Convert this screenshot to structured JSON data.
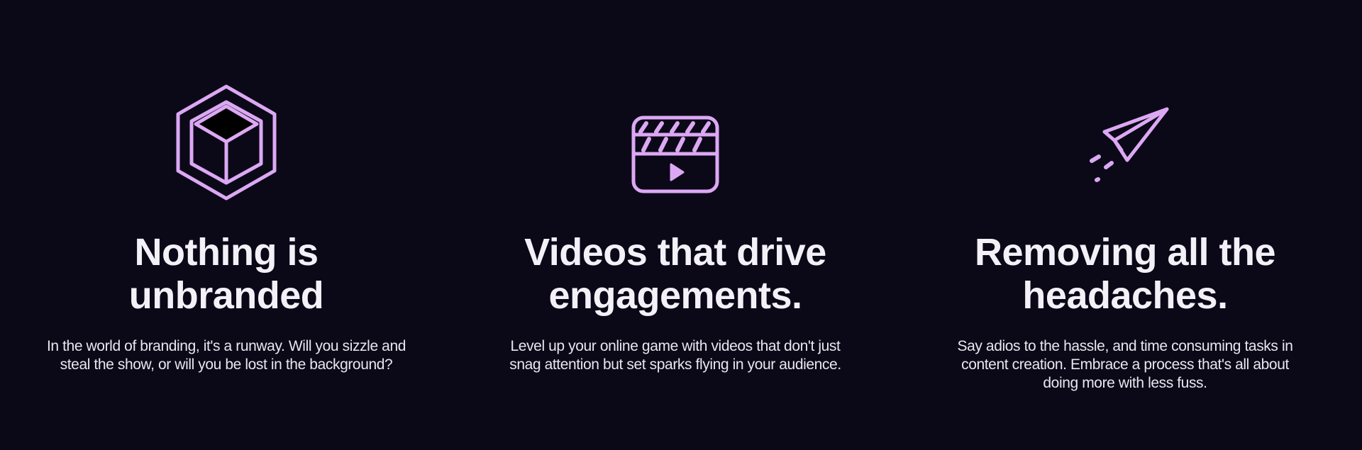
{
  "theme": {
    "background": "#0b0918",
    "accent": "#dca8f3",
    "text": "#f3f1f7"
  },
  "features": [
    {
      "icon": "hexagon-cube-icon",
      "title_lines": [
        "Nothing is",
        "unbranded"
      ],
      "description_lines": [
        "In the world of branding, it's a runway. Will you sizzle and",
        "steal the show, or will you be lost in the background?"
      ]
    },
    {
      "icon": "clapperboard-play-icon",
      "title_lines": [
        "Videos that drive",
        "engagements."
      ],
      "description_lines": [
        "Level up your online game with videos that don't just",
        "snag attention but set sparks flying in your audience."
      ]
    },
    {
      "icon": "paper-plane-icon",
      "title_lines": [
        "Removing all the",
        "headaches."
      ],
      "description_lines": [
        "Say adios to the hassle, and time consuming tasks in",
        "content creation. Embrace a process that's all about",
        "doing more with less fuss."
      ]
    }
  ]
}
